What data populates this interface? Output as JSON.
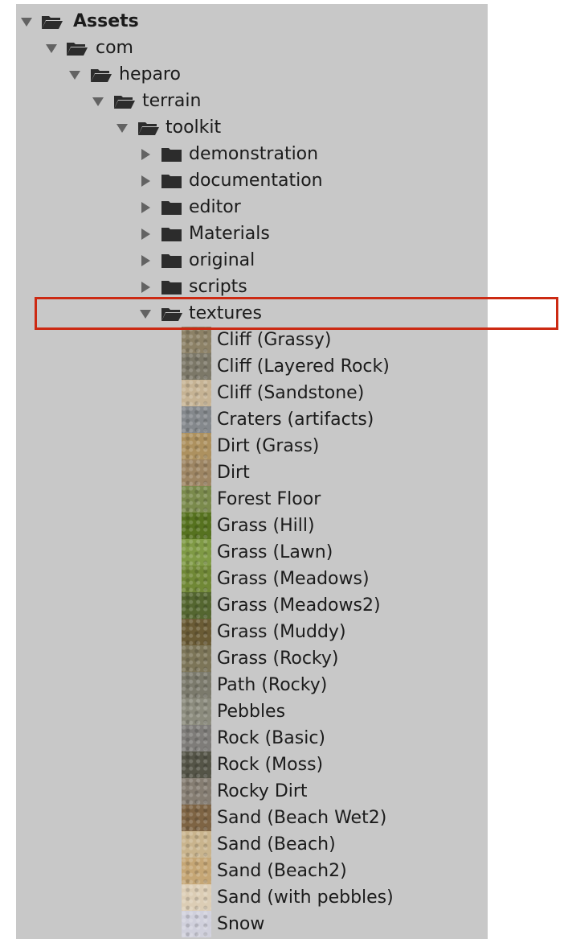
{
  "tree": {
    "assets_label": "Assets",
    "com_label": "com",
    "heparo_label": "heparo",
    "terrain_label": "terrain",
    "toolkit_label": "toolkit",
    "folders": [
      "demonstration",
      "documentation",
      "editor",
      "Materials",
      "original",
      "scripts"
    ],
    "textures_label": "textures",
    "textures": [
      {
        "label": "Cliff (Grassy)",
        "color": "#8c8166"
      },
      {
        "label": "Cliff (Layered Rock)",
        "color": "#7c7868"
      },
      {
        "label": "Cliff (Sandstone)",
        "color": "#c6b394"
      },
      {
        "label": "Craters (artifacts)",
        "color": "#84888c"
      },
      {
        "label": "Dirt (Grass)",
        "color": "#ad915f"
      },
      {
        "label": "Dirt",
        "color": "#9d8563"
      },
      {
        "label": "Forest Floor",
        "color": "#7a8a4c"
      },
      {
        "label": "Grass (Hill)",
        "color": "#56721f"
      },
      {
        "label": "Grass (Lawn)",
        "color": "#7f9a45"
      },
      {
        "label": "Grass (Meadows)",
        "color": "#708836"
      },
      {
        "label": "Grass (Meadows2)",
        "color": "#546630"
      },
      {
        "label": "Grass (Muddy)",
        "color": "#6a5b35"
      },
      {
        "label": "Grass (Rocky)",
        "color": "#7c7558"
      },
      {
        "label": "Path (Rocky)",
        "color": "#7b7a6c"
      },
      {
        "label": "Pebbles",
        "color": "#8b8b7d"
      },
      {
        "label": "Rock (Basic)",
        "color": "#7e7c79"
      },
      {
        "label": "Rock (Moss)",
        "color": "#545447"
      },
      {
        "label": "Rocky Dirt",
        "color": "#857d72"
      },
      {
        "label": "Sand (Beach Wet2)",
        "color": "#7e6444"
      },
      {
        "label": "Sand (Beach)",
        "color": "#c9b48d"
      },
      {
        "label": "Sand (Beach2)",
        "color": "#c5a675"
      },
      {
        "label": "Sand (with pebbles)",
        "color": "#dccdb5"
      },
      {
        "label": "Snow",
        "color": "#d0d0dc"
      }
    ]
  },
  "colors": {
    "panel_background": "#c8c8c8",
    "highlight_border": "#cc2a13",
    "arrow": "#636363",
    "folder": "#2c2c2c"
  }
}
